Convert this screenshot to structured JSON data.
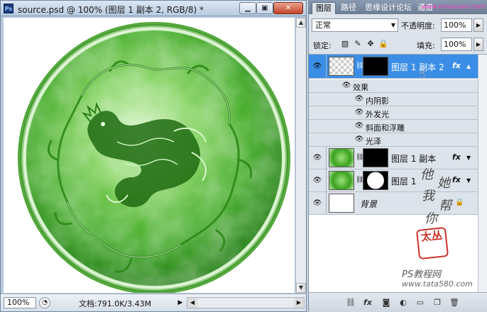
{
  "document": {
    "ps_badge": "Ps",
    "title": "source.psd @ 100% (图层 1 副本 2, RGB/8) *",
    "buttons": {
      "minimize": "▁",
      "maximize": "▣",
      "close": "✕"
    },
    "status": {
      "zoom": "100%",
      "info": "文档:791.0K/3.43M"
    }
  },
  "panel": {
    "tabs": [
      {
        "label": "图层",
        "active": true
      },
      {
        "label": "路径",
        "active": false
      },
      {
        "label": "思缘设计论坛",
        "active": false
      },
      {
        "label": "通道",
        "active": false
      }
    ],
    "tab_watermark": "www.missvuan.com",
    "blend_mode": "正常",
    "opacity_label": "不透明度:",
    "opacity_value": "100%",
    "lock_label": "锁定:",
    "fill_label": "填充:",
    "fill_value": "100%",
    "layers": [
      {
        "name": "图层 1 副本 2",
        "selected": true,
        "fx": "fx",
        "effects_header": "效果",
        "effects": [
          "内阴影",
          "外发光",
          "斜面和浮雕",
          "光泽"
        ]
      },
      {
        "name": "图层 1 副本",
        "selected": false,
        "fx": "fx"
      },
      {
        "name": "图层 1",
        "selected": false,
        "fx": "fx"
      },
      {
        "name": "背景",
        "selected": false,
        "locked": true
      }
    ]
  },
  "watermarks": {
    "handwriting": [
      "他",
      "她",
      "我",
      "帮",
      "你"
    ],
    "seal_text": "太丛",
    "site_cn": "PS教程网",
    "site_url": "www.tata580.com"
  },
  "colors": {
    "jade_light": "#c9f0b8",
    "jade_mid": "#4cb82e",
    "jade_dark": "#1f7a12",
    "selection_blue": "#3a8ee6"
  }
}
